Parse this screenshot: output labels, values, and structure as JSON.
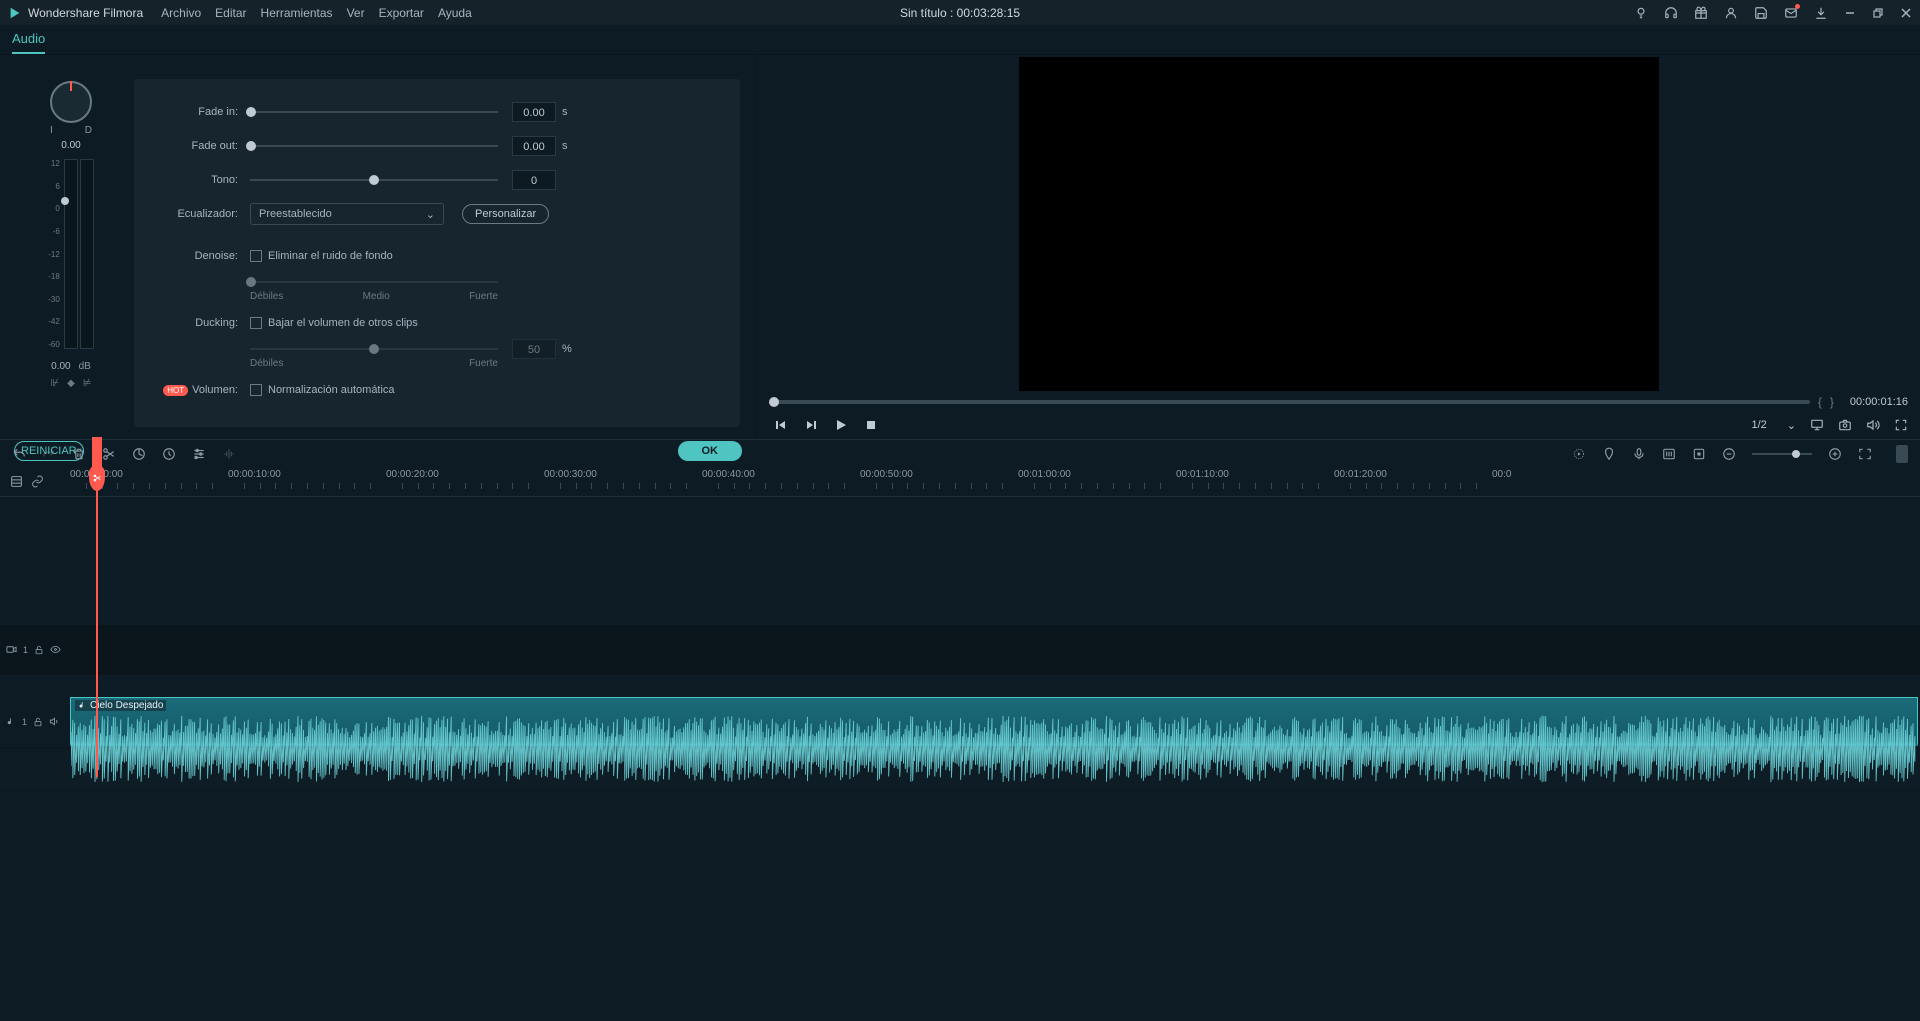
{
  "app": {
    "name": "Wondershare Filmora"
  },
  "menu": {
    "file": "Archivo",
    "edit": "Editar",
    "tools": "Herramientas",
    "view": "Ver",
    "export": "Exportar",
    "help": "Ayuda"
  },
  "title": "Sin título : 00:03:28:15",
  "tab": {
    "audio": "Audio"
  },
  "knob": {
    "i": "I",
    "d": "D",
    "val": "0.00",
    "vu_val": "0.00",
    "db": "dB",
    "ticks": [
      "12",
      "6",
      "0",
      "-6",
      "-12",
      "-18",
      "-30",
      "-42",
      "-60"
    ]
  },
  "panel": {
    "fade_in_lbl": "Fade in:",
    "fade_in_val": "0.00",
    "sec": "s",
    "fade_out_lbl": "Fade out:",
    "fade_out_val": "0.00",
    "tone_lbl": "Tono:",
    "tone_val": "0",
    "eq_lbl": "Ecualizador:",
    "eq_val": "Preestablecido",
    "customize": "Personalizar",
    "denoise_lbl": "Denoise:",
    "denoise_chk": "Eliminar el ruido de fondo",
    "weak": "Débiles",
    "medium": "Medio",
    "strong": "Fuerte",
    "ducking_lbl": "Ducking:",
    "ducking_chk": "Bajar el volumen de otros clips",
    "ducking_val": "50",
    "pct": "%",
    "volume_lbl": "Volumen:",
    "volume_chk": "Normalización automática"
  },
  "buttons": {
    "reset": "REINICIAR",
    "ok": "OK"
  },
  "preview": {
    "timecode": "00:00:01:16",
    "resolution": "1/2"
  },
  "ruler": [
    "00:00:00:00",
    "00:00:10:00",
    "00:00:20:00",
    "00:00:30:00",
    "00:00:40:00",
    "00:00:50:00",
    "00:01:00:00",
    "00:01:10:00",
    "00:01:20:00",
    "00:0"
  ],
  "ruler_tail": "00:0",
  "tracks": {
    "video1": "1",
    "audio1": "1",
    "clip_title": "Cielo Despejado"
  }
}
